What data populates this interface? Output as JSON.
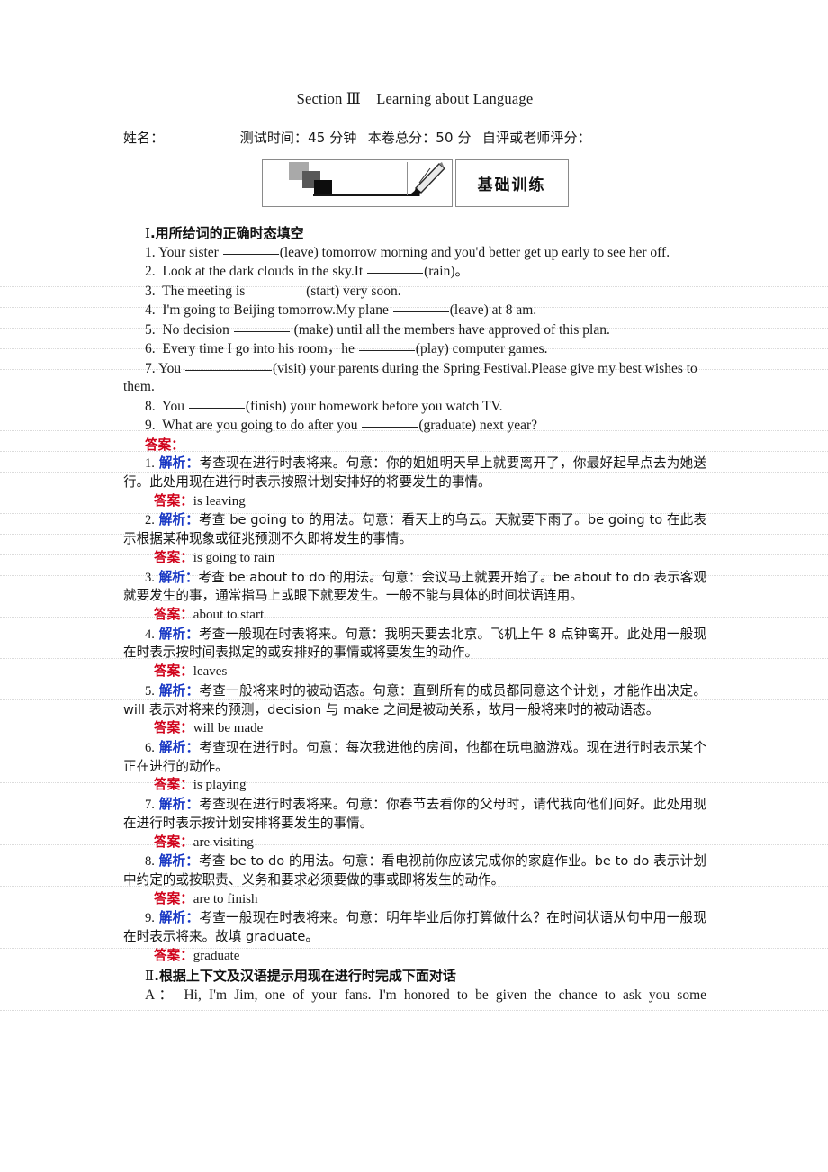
{
  "title": "Section Ⅲ    Learning about Language",
  "info_line": {
    "name_label": "姓名：",
    "time_label": "测试时间：45 分钟",
    "total_label": "本卷总分：50 分",
    "score_label": "自评或老师评分："
  },
  "banner": {
    "badge_text": "基础训练",
    "deco_icon": "pencil-drawing-icon"
  },
  "section1": {
    "heading_numeral": "Ⅰ",
    "heading_text": ".用所给词的正确时态填空",
    "questions": [
      {
        "num": "1.",
        "pre": "Your sister ",
        "post": "(leave) tomorrow morning and you'd better get up early to see her off."
      },
      {
        "num": "2.",
        "pre": "Look at the dark clouds in the sky.It ",
        "post": "(rain)。"
      },
      {
        "num": "3.",
        "pre": "The meeting is ",
        "post": "(start) very soon."
      },
      {
        "num": "4.",
        "pre": "I'm going to Beijing tomorrow.My plane ",
        "post": "(leave) at 8 am."
      },
      {
        "num": "5.",
        "pre": "No decision ",
        "post": " (make) until all the members have approved of this plan."
      },
      {
        "num": "6.",
        "pre": "Every time I go into his room，he ",
        "post": "(play) computer games."
      },
      {
        "num": "7.",
        "pre": "You ",
        "post": "(visit) your parents during the Spring Festival.Please give my best wishes to them."
      },
      {
        "num": "8.",
        "pre": "You ",
        "post": "(finish) your homework before you watch TV."
      },
      {
        "num": "9.",
        "pre": "What are you going to do after you ",
        "post": "(graduate) next year?"
      }
    ],
    "answers_header": "答案：",
    "label_answer": "答案：",
    "label_analysis": "解析：",
    "items": [
      {
        "num": "1.",
        "analysis": "考查现在进行时表将来。句意：你的姐姐明天早上就要离开了，你最好起早点去为她送行。此处用现在进行时表示按照计划安排好的将要发生的事情。",
        "answer": "is leaving"
      },
      {
        "num": "2.",
        "analysis": "考查 be going to 的用法。句意：看天上的乌云。天就要下雨了。be going to 在此表示根据某种现象或征兆预测不久即将发生的事情。",
        "answer": "is going to rain"
      },
      {
        "num": "3.",
        "analysis": "考查 be about to do 的用法。句意：会议马上就要开始了。be about to do 表示客观就要发生的事，通常指马上或眼下就要发生。一般不能与具体的时间状语连用。",
        "answer": "about to start"
      },
      {
        "num": "4.",
        "analysis": "考查一般现在时表将来。句意：我明天要去北京。飞机上午 8 点钟离开。此处用一般现在时表示按时间表拟定的或安排好的事情或将要发生的动作。",
        "answer": "leaves"
      },
      {
        "num": "5.",
        "analysis": "考查一般将来时的被动语态。句意：直到所有的成员都同意这个计划，才能作出决定。will 表示对将来的预测，decision 与 make 之间是被动关系，故用一般将来时的被动语态。",
        "answer": "will be made"
      },
      {
        "num": "6.",
        "analysis": "考查现在进行时。句意：每次我进他的房间，他都在玩电脑游戏。现在进行时表示某个正在进行的动作。",
        "answer": "is playing"
      },
      {
        "num": "7.",
        "analysis": "考查现在进行时表将来。句意：你春节去看你的父母时，请代我向他们问好。此处用现在进行时表示按计划安排将要发生的事情。",
        "answer": "are visiting"
      },
      {
        "num": "8.",
        "analysis": "考查 be to do 的用法。句意：看电视前你应该完成你的家庭作业。be to do 表示计划中约定的或按职责、义务和要求必须要做的事或即将发生的动作。",
        "answer": "are to finish"
      },
      {
        "num": "9.",
        "analysis": "考查一般现在时表将来。句意：明年毕业后你打算做什么？在时间状语从句中用一般现在时表示将来。故填 graduate。",
        "answer": "graduate"
      }
    ]
  },
  "section2": {
    "heading_numeral": "Ⅱ",
    "heading_text": ".根据上下文及汉语提示用现在进行时完成下面对话",
    "dialog": [
      {
        "speaker": "A：",
        "text": "Hi, I'm Jim, one of your fans. I'm honored to be given the chance to ask you some"
      }
    ]
  },
  "colors": {
    "answer_label": "#d0021b",
    "analysis_label": "#1636c4",
    "text": "#1a1a1a"
  }
}
